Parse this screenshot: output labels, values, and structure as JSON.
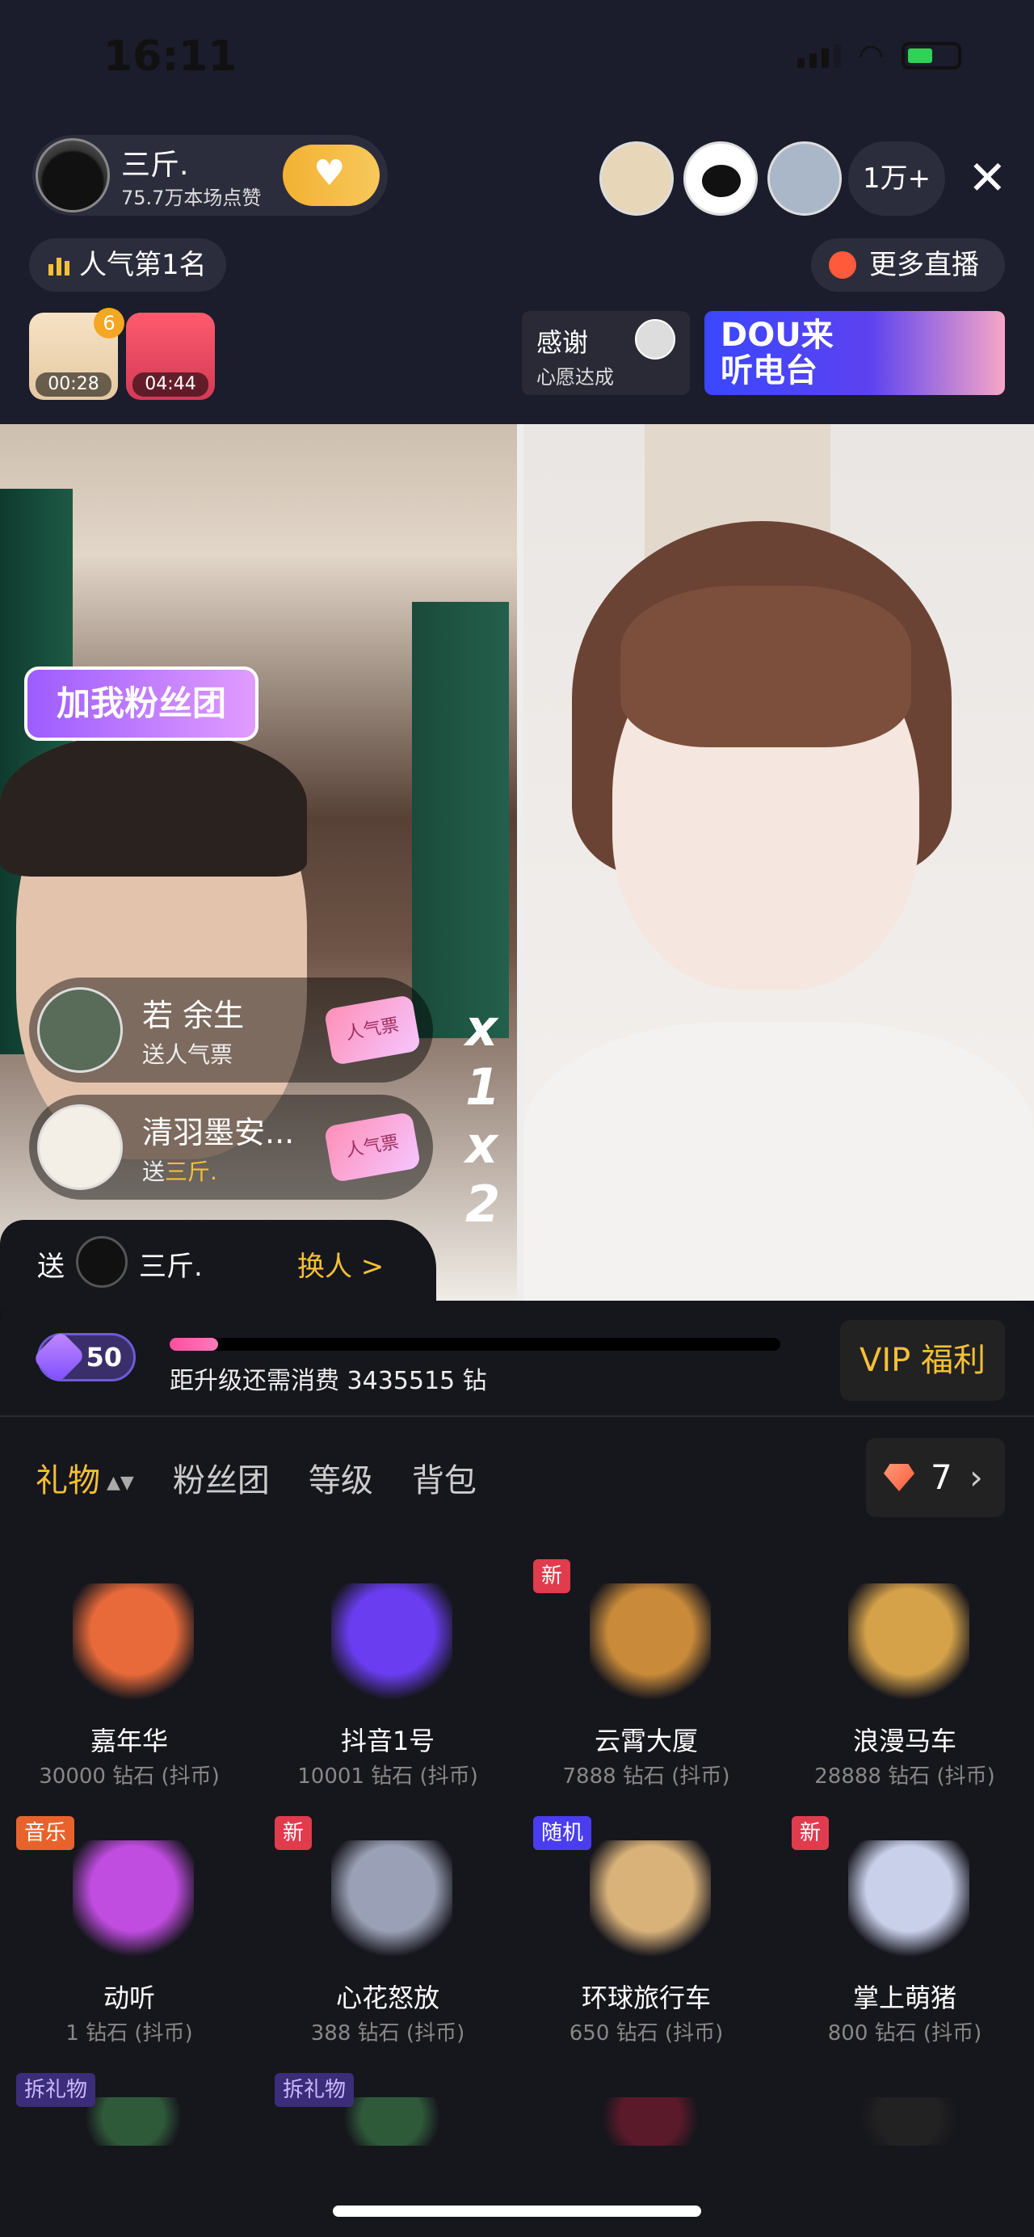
{
  "status_bar": {
    "time": "16:11"
  },
  "header": {
    "anchor_name": "三斤.",
    "anchor_likes": "75.7万本场点赞",
    "viewer_count": "1万+",
    "rank_label": "人气第1名",
    "more_live": "更多直播",
    "gift_timers": [
      {
        "time": "00:28",
        "badge": "6"
      },
      {
        "time": "04:44"
      }
    ],
    "thanks_title": "感谢",
    "thanks_sub": "心愿达成",
    "banner_text": "DOU来\n听电台"
  },
  "video": {
    "fan_sign": "加我粉丝团",
    "gift_notices": [
      {
        "name": "若 余生",
        "sub": "送人气票",
        "gift": "人气票",
        "count": "x 1"
      },
      {
        "name": "清羽墨安...",
        "sub_prefix": "送",
        "sub_target": "三斤.",
        "gift": "人气票",
        "count": "x 2"
      }
    ]
  },
  "panel": {
    "send_label": "送",
    "send_target": "三斤.",
    "change_label": "换人 >",
    "level": "50",
    "progress": 0.08,
    "upgrade_text": "距升级还需消费 3435515 钻",
    "vip_label": "VIP 福利",
    "tabs": [
      "礼物",
      "粉丝团",
      "等级",
      "背包"
    ],
    "diamonds": "7",
    "gifts": [
      {
        "name": "嘉年华",
        "price": "30000 钻石 (抖币)",
        "tag": "",
        "color": "#e86a3a"
      },
      {
        "name": "抖音1号",
        "price": "10001 钻石 (抖币)",
        "tag": "",
        "color": "#6a3df0"
      },
      {
        "name": "云霄大厦",
        "price": "7888 钻石 (抖币)",
        "tag": "新",
        "color": "#c98a3a"
      },
      {
        "name": "浪漫马车",
        "price": "28888 钻石 (抖币)",
        "tag": "",
        "color": "#d5a24a"
      },
      {
        "name": "动听",
        "price": "1 钻石 (抖币)",
        "tag": "音乐",
        "color": "#c04ce0"
      },
      {
        "name": "心花怒放",
        "price": "388 钻石 (抖币)",
        "tag": "新",
        "color": "#9aa0b5"
      },
      {
        "name": "环球旅行车",
        "price": "650 钻石 (抖币)",
        "tag": "随机",
        "color": "#d9b27a"
      },
      {
        "name": "掌上萌猪",
        "price": "800 钻石 (抖币)",
        "tag": "新",
        "color": "#c8d0ea"
      },
      {
        "name": "",
        "price": "",
        "tag": "拆礼物",
        "color": "#2f5a3a"
      },
      {
        "name": "",
        "price": "",
        "tag": "拆礼物",
        "color": "#2f5a3a"
      },
      {
        "name": "",
        "price": "",
        "tag": "",
        "color": "#5a1a2a"
      },
      {
        "name": "",
        "price": "",
        "tag": "",
        "color": "#222"
      }
    ]
  }
}
